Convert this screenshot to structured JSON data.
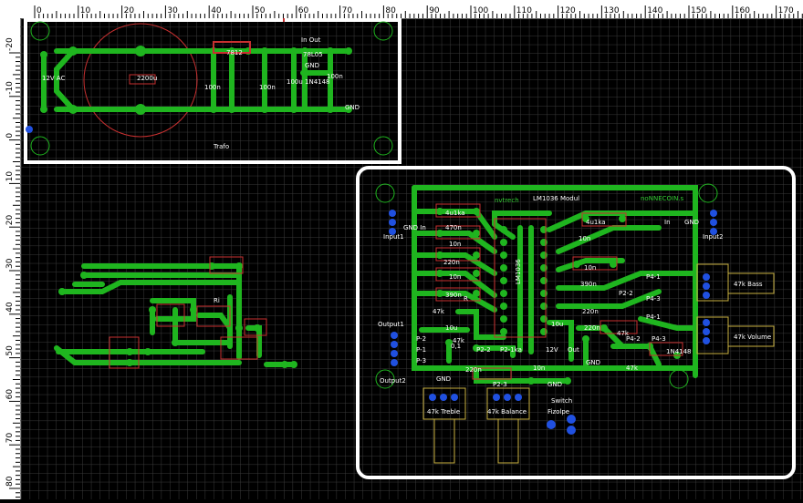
{
  "ruler": {
    "unit": "mm",
    "top_ticks": [
      "0",
      "10",
      "20",
      "30",
      "40",
      "50",
      "60",
      "70",
      "80",
      "90",
      "100",
      "110",
      "120",
      "130",
      "140",
      "150",
      "160",
      "170"
    ],
    "left_ticks": [
      "-20",
      "-10",
      "0",
      "10",
      "20",
      "30",
      "40",
      "50",
      "60",
      "70",
      "80"
    ]
  },
  "board1": {
    "labels": {
      "ac": "12V AC",
      "cap": "2200u",
      "reg1": "7812",
      "c1": "100n",
      "c2": "100n",
      "c3": "100u",
      "c4": "100n",
      "reg2": "78L05",
      "inout": "In Out",
      "gnd": "GND",
      "diode": "1N4148",
      "gnd2": "GND",
      "title": "Trafo"
    }
  },
  "board3": {
    "labels": {
      "title": "LM1036 Modul",
      "brand1": "nvtrech",
      "brand2": "noNNECOIN.s",
      "gnd_in": "GND In",
      "input1": "Input1",
      "input2": "Input2",
      "in": "In",
      "gnd": "GND",
      "output1": "Output1",
      "output2": "Output2",
      "p2": "P-2",
      "p1": "P-1",
      "p3": "P-3",
      "p2_2": "P2-2",
      "p2_1": "P2-1ka",
      "p3_3": "P2-3",
      "p4_1": "P4-1",
      "p4_3": "P4-3",
      "p4_2": "P4-2",
      "p2_x": "P2-2",
      "twelve": "12V",
      "out": "Out",
      "gnd_b": "GND",
      "gnd_c": "GND",
      "gnd_d": "GND",
      "treble": "47k Treble",
      "balance": "47k Balance",
      "bass": "47k Bass",
      "volume": "47k Volume",
      "switch": "Switch",
      "fizolpe": "Fizolpe",
      "r1": "4u1ka",
      "r2": "470n",
      "r3": "10n",
      "r4": "220n",
      "r5": "10n",
      "r6": "390n",
      "r7": "47k",
      "r8": "10u",
      "r9": "0,1",
      "r10": "47k",
      "r11": "220n",
      "r12": "4u1ka",
      "r13": "10n",
      "r14": "10n",
      "r15": "390n",
      "r16": "220n",
      "r17": "220n",
      "r18": "47k",
      "r19": "10u",
      "r20": "47k",
      "r21": "10n",
      "r22": "1N4148",
      "chip": "LM1036",
      "r": "R",
      "ri": "Ri"
    }
  },
  "colors": {
    "background": "#000000",
    "grid": "#3a3a3a",
    "copper": "#1fb51f",
    "outline": "#ffffff",
    "silk": "#c83030",
    "pad": "#2050e0",
    "yellow": "#c8b040"
  }
}
